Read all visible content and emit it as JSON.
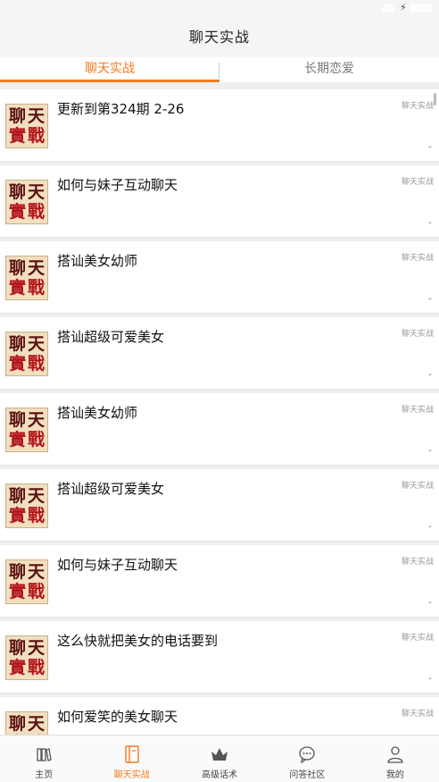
{
  "header": {
    "title": "聊天实战"
  },
  "tabs": [
    {
      "label": "聊天实战",
      "active": true
    },
    {
      "label": "长期恋爱",
      "active": false
    }
  ],
  "thumbnail": {
    "chars": [
      "聊",
      "天",
      "實",
      "戰"
    ]
  },
  "list": [
    {
      "title": "更新到第324期  2-26",
      "tag": "聊天实战",
      "mark": "ᵕ"
    },
    {
      "title": "如何与妹子互动聊天",
      "tag": "聊天实战",
      "mark": "ᵕ"
    },
    {
      "title": "搭讪美女幼师",
      "tag": "聊天实战",
      "mark": "ᵕ"
    },
    {
      "title": "搭讪超级可爱美女",
      "tag": "聊天实战",
      "mark": "ᵕ"
    },
    {
      "title": "搭讪美女幼师",
      "tag": "聊天实战",
      "mark": "ᵕ"
    },
    {
      "title": "搭讪超级可爱美女",
      "tag": "聊天实战",
      "mark": "ᵕ"
    },
    {
      "title": "如何与妹子互动聊天",
      "tag": "聊天实战",
      "mark": "ᵕ"
    },
    {
      "title": "这么快就把美女的电话要到",
      "tag": "聊天实战",
      "mark": "ᵕ"
    },
    {
      "title": "如何爱笑的美女聊天",
      "tag": "聊天实战",
      "mark": "ᵕ"
    }
  ],
  "bottom_nav": [
    {
      "label": "主页",
      "icon": "books-icon",
      "active": false
    },
    {
      "label": "聊天实战",
      "icon": "notebook-icon",
      "active": true
    },
    {
      "label": "高级话术",
      "icon": "crown-icon",
      "active": false
    },
    {
      "label": "问答社区",
      "icon": "chat-bubble-icon",
      "active": false
    },
    {
      "label": "我的",
      "icon": "user-icon",
      "active": false
    }
  ],
  "colors": {
    "accent": "#f27b1c",
    "background": "#eeeeee",
    "card": "#ffffff",
    "thumb_red": "#b3161a"
  }
}
